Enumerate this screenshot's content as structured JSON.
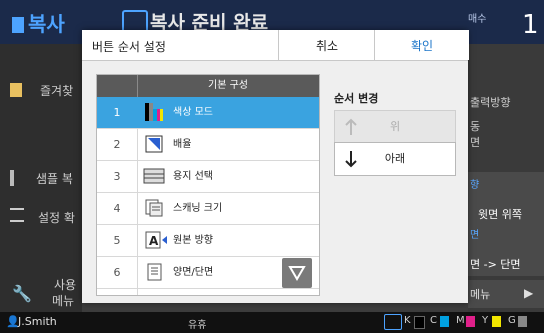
{
  "app": {
    "title": "복사",
    "status_message": "복사 준비 완료",
    "copies_label": "매수",
    "copies_value": "1"
  },
  "left_panel": {
    "items": [
      {
        "label": "즐겨찾"
      },
      {
        "label": "샘플 복"
      },
      {
        "label": "설정 확"
      },
      {
        "label": "사용"
      },
      {
        "label": "메뉴"
      }
    ]
  },
  "right_panel": {
    "lines": [
      {
        "text": "출력방향"
      },
      {
        "text": "동"
      },
      {
        "text": "면"
      },
      {
        "text": "향"
      },
      {
        "text": "윗면 위쪽"
      },
      {
        "text": "면"
      },
      {
        "text": "면 -> 단면"
      },
      {
        "text": "메뉴"
      }
    ]
  },
  "dialog": {
    "title": "버튼 순서 설정",
    "cancel_label": "취소",
    "ok_label": "확인",
    "list_header": "기본 구성",
    "rows": [
      {
        "num": "1",
        "label": "색상 모드",
        "icon": "color-mode-icon",
        "selected": true
      },
      {
        "num": "2",
        "label": "배율",
        "icon": "zoom-icon",
        "selected": false
      },
      {
        "num": "3",
        "label": "용지 선택",
        "icon": "paper-select-icon",
        "selected": false
      },
      {
        "num": "4",
        "label": "스캐닝 크기",
        "icon": "scan-size-icon",
        "selected": false
      },
      {
        "num": "5",
        "label": "원본 방향",
        "icon": "original-direction-icon",
        "selected": false
      },
      {
        "num": "6",
        "label": "양면/단면",
        "icon": "duplex-icon",
        "selected": false
      }
    ],
    "order_change_title": "순서 변경",
    "up_label": "위",
    "down_label": "아래"
  },
  "bottom_bar": {
    "user": "J.Smith",
    "status": "유휴",
    "inks": [
      {
        "label": "K",
        "color": "#000000"
      },
      {
        "label": "C",
        "color": "#00a0e0"
      },
      {
        "label": "M",
        "color": "#e0208a"
      },
      {
        "label": "Y",
        "color": "#f2e600"
      },
      {
        "label": "G",
        "color": "#888888"
      }
    ]
  },
  "colors": {
    "accent": "#3aa3e0",
    "ok_text": "#1a75c9",
    "title_blue": "#4da3ff"
  }
}
